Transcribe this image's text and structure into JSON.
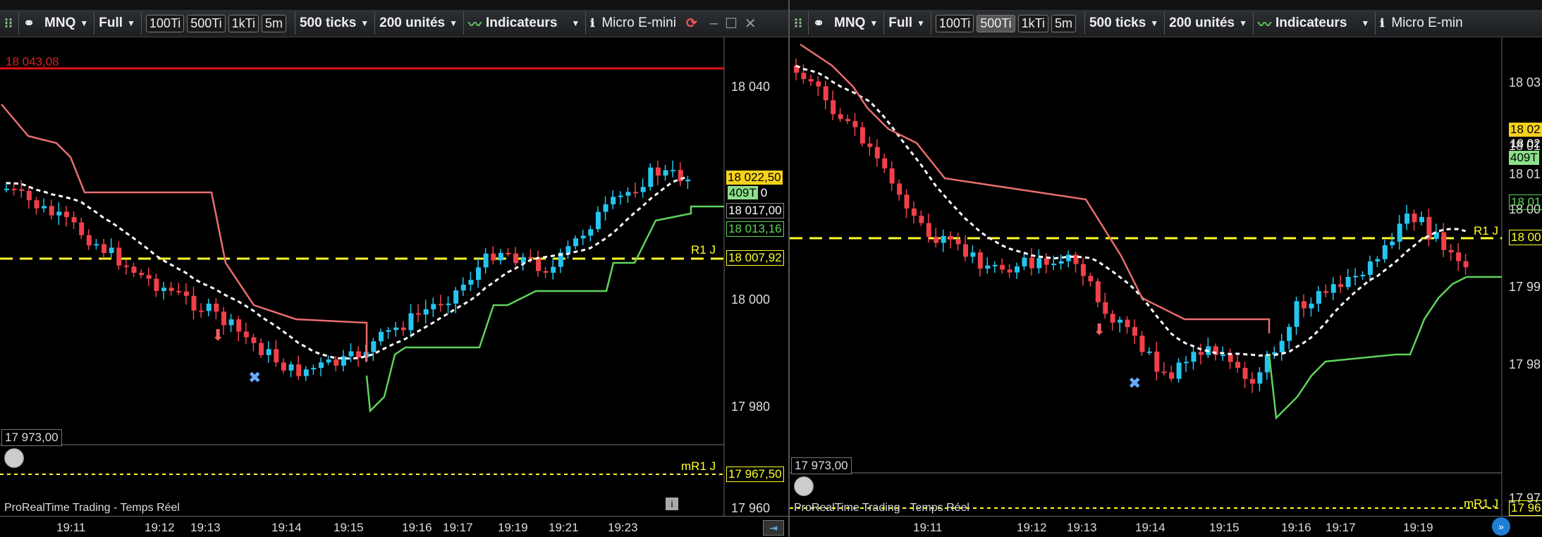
{
  "colors": {
    "up": "#25c5ef",
    "down": "#f0404a",
    "support": "#5fd35a",
    "resistance": "#e86e6e",
    "pivot": "#ffff2a",
    "sma": "#ffffff",
    "price_tag": "#f6d21b",
    "volume_tag": "#8de08a",
    "level_line": "#e01010"
  },
  "left": {
    "toolbar": {
      "symbol": "MNQ",
      "mode": "Full",
      "chips": [
        "100Ti",
        "500Ti",
        "1kTi",
        "5m"
      ],
      "active_chip": "",
      "ticks": "500 ticks",
      "units": "200 unités",
      "indicators": "Indicateurs",
      "instrument": "Micro E-mini"
    },
    "level_top_label": "18 043,08",
    "price_axis": [
      "18 040",
      "18 000",
      "17 980",
      "17 960"
    ],
    "tags": {
      "last": "18 022,50",
      "volume": "409T",
      "vol_suffix": "0",
      "p1": "18 017,00",
      "p2": "18 013,16",
      "pivot": "18 007,92",
      "mr1": "17 967,50"
    },
    "r1_label": "R1 J",
    "mr1_label": "mR1 J",
    "bottom_box": "17 973,00",
    "footer": "ProRealTime Trading - Temps Réel",
    "time_axis": [
      "19:11",
      "19:12",
      "19:13",
      "19:14",
      "19:15",
      "19:16",
      "19:17",
      "19:19",
      "19:21",
      "19:23"
    ]
  },
  "right": {
    "toolbar": {
      "symbol": "MNQ",
      "mode": "Full",
      "chips": [
        "100Ti",
        "500Ti",
        "1kTi",
        "5m"
      ],
      "active_chip": "500Ti",
      "ticks": "500 ticks",
      "units": "200 unités",
      "indicators": "Indicateurs",
      "instrument": "Micro E-min"
    },
    "price_axis": [
      "18 03",
      "18 01",
      "18 01",
      "18 00",
      "17 99",
      "17 98",
      "17 97"
    ],
    "tags": {
      "last": "18 02",
      "p0": "18 02",
      "volume": "409T",
      "p2": "18 01",
      "pivot": "18 00",
      "mr1": "17 96"
    },
    "r1_label": "R1 J",
    "mr1_label": "mR1 J",
    "bottom_box": "17 973,00",
    "footer": "ProRealTime Trading - Temps Réel",
    "time_axis": [
      "19:11",
      "19:12",
      "19:13",
      "19:14",
      "19:15",
      "19:16",
      "19:17",
      "19:19"
    ]
  }
}
